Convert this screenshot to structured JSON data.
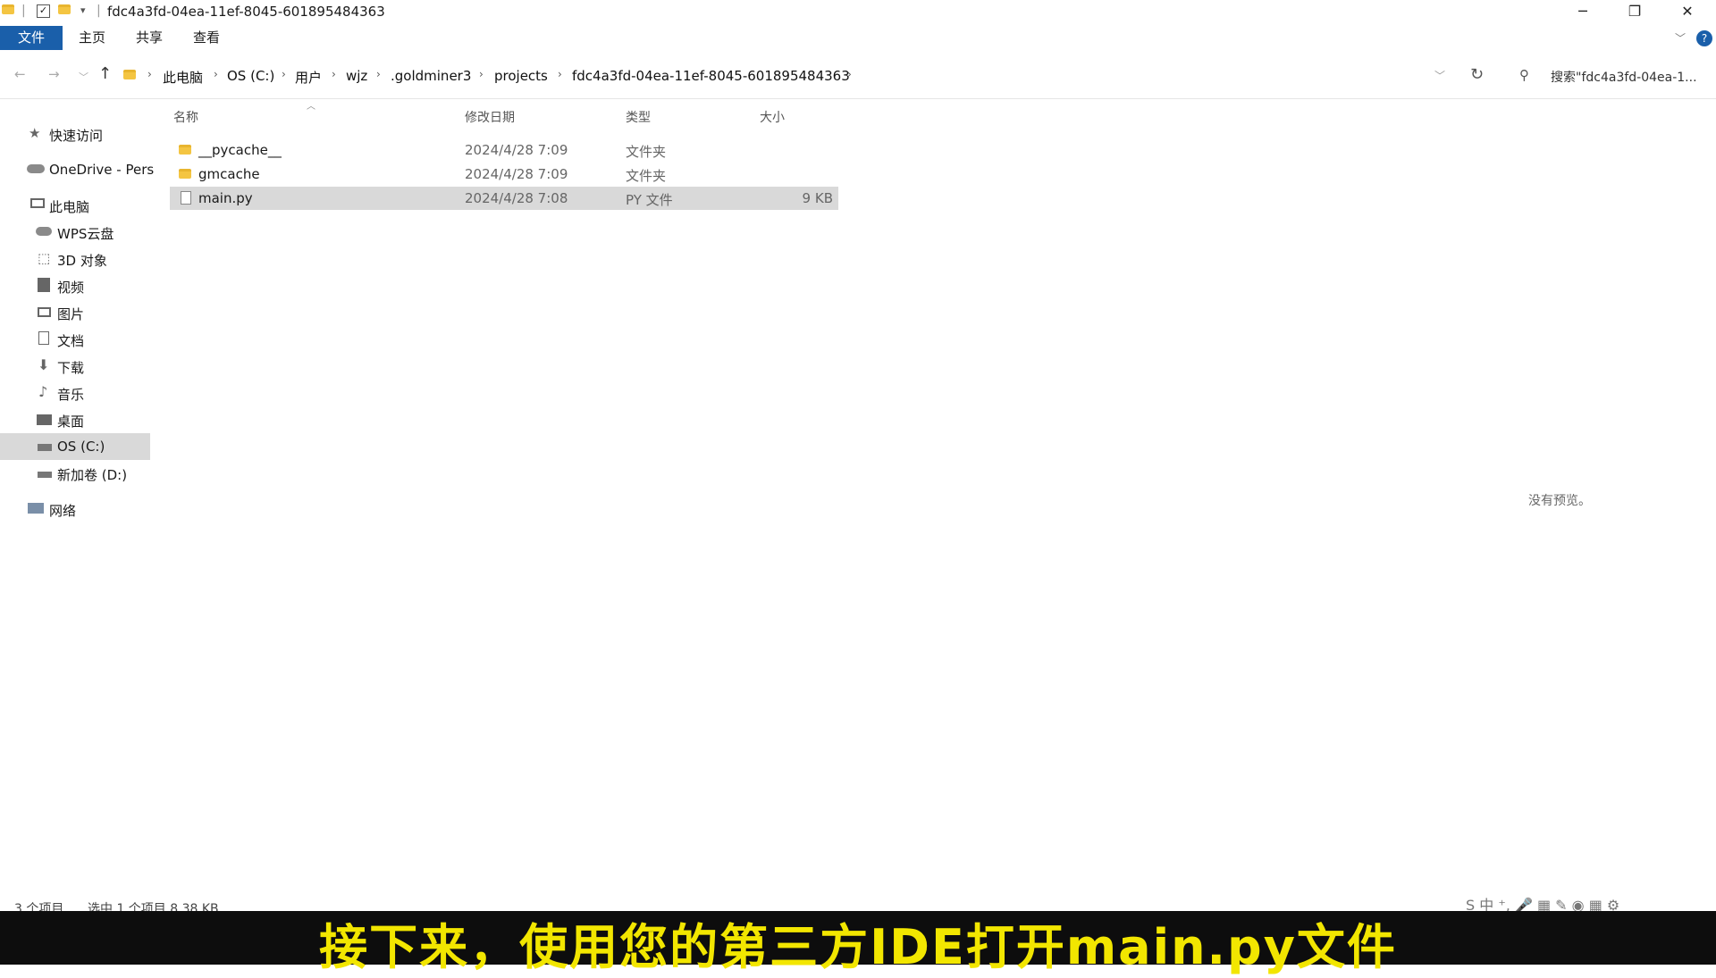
{
  "window": {
    "title": "fdc4a3fd-04ea-11ef-8045-601895484363",
    "controls": {
      "minimize": "─",
      "restore": "❐",
      "close": "✕"
    }
  },
  "ribbon": {
    "tabs": [
      "文件",
      "主页",
      "共享",
      "查看"
    ],
    "help": "?"
  },
  "address": {
    "crumbs": [
      "此电脑",
      "OS (C:)",
      "用户",
      "wjz",
      ".goldminer3",
      "projects",
      "fdc4a3fd-04ea-11ef-8045-601895484363"
    ],
    "search_placeholder": "搜索\"fdc4a3fd-04ea-1..."
  },
  "sidebar": {
    "items": [
      {
        "label": "快速访问",
        "icon": "star-icon"
      },
      {
        "label": "OneDrive - Pers",
        "icon": "cloud-icon"
      },
      {
        "label": "此电脑",
        "icon": "computer-icon"
      },
      {
        "label": "WPS云盘",
        "icon": "cloud-icon"
      },
      {
        "label": "3D 对象",
        "icon": "cube-icon"
      },
      {
        "label": "视频",
        "icon": "video-icon"
      },
      {
        "label": "图片",
        "icon": "picture-icon"
      },
      {
        "label": "文档",
        "icon": "document-icon"
      },
      {
        "label": "下载",
        "icon": "download-icon"
      },
      {
        "label": "音乐",
        "icon": "music-icon"
      },
      {
        "label": "桌面",
        "icon": "desktop-icon"
      },
      {
        "label": "OS (C:)",
        "icon": "drive-icon"
      },
      {
        "label": "新加卷 (D:)",
        "icon": "drive-icon"
      },
      {
        "label": "网络",
        "icon": "network-icon"
      }
    ]
  },
  "filelist": {
    "columns": {
      "name": "名称",
      "date": "修改日期",
      "type": "类型",
      "size": "大小"
    },
    "rows": [
      {
        "name": "__pycache__",
        "date": "2024/4/28 7:09",
        "type": "文件夹",
        "size": ""
      },
      {
        "name": "gmcache",
        "date": "2024/4/28 7:09",
        "type": "文件夹",
        "size": ""
      },
      {
        "name": "main.py",
        "date": "2024/4/28 7:08",
        "type": "PY 文件",
        "size": "9 KB"
      }
    ]
  },
  "preview_text": "没有预览。",
  "status": {
    "count": "3 个项目",
    "selection": "选中 1 个项目  8.38 KB"
  },
  "subtitle": "接下来，使用您的第三方IDE打开main.py文件",
  "colors": {
    "accent": "#1a5faa",
    "subtitle": "#f2e600",
    "folder": "#f4c542"
  }
}
